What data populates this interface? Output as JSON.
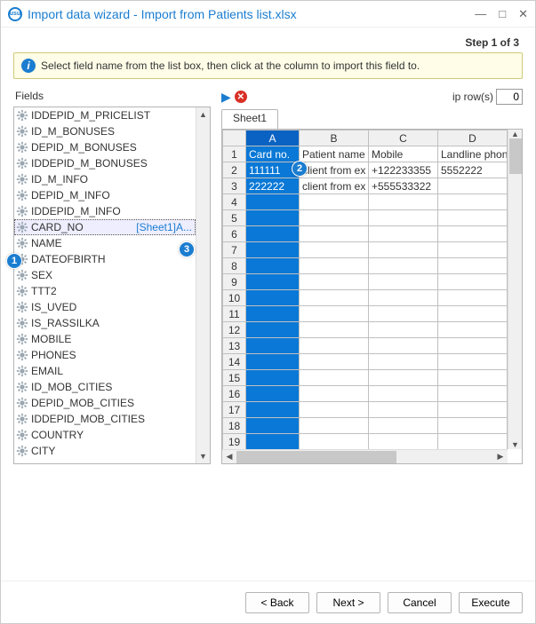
{
  "window": {
    "title": "Import data wizard - Import from Patients list.xlsx"
  },
  "step_label": "Step 1 of 3",
  "info_text": "Select field name from the list box, then click at the column to import this field to.",
  "fields_label": "Fields",
  "fields": [
    {
      "name": "IDDEPID_M_PRICELIST"
    },
    {
      "name": "ID_M_BONUSES"
    },
    {
      "name": "DEPID_M_BONUSES"
    },
    {
      "name": "IDDEPID_M_BONUSES"
    },
    {
      "name": "ID_M_INFO"
    },
    {
      "name": "DEPID_M_INFO"
    },
    {
      "name": "IDDEPID_M_INFO"
    },
    {
      "name": "CARD_NO",
      "selected": true,
      "mapping": "[Sheet1]A..."
    },
    {
      "name": "NAME"
    },
    {
      "name": "DATEOFBIRTH"
    },
    {
      "name": "SEX"
    },
    {
      "name": "TTT2"
    },
    {
      "name": "IS_UVED"
    },
    {
      "name": "IS_RASSILKA"
    },
    {
      "name": "MOBILE"
    },
    {
      "name": "PHONES"
    },
    {
      "name": "EMAIL"
    },
    {
      "name": "ID_MOB_CITIES"
    },
    {
      "name": "DEPID_MOB_CITIES"
    },
    {
      "name": "IDDEPID_MOB_CITIES"
    },
    {
      "name": "COUNTRY"
    },
    {
      "name": "CITY"
    }
  ],
  "skip_label": "ip row(s)",
  "skip_value": "0",
  "sheet_tab": "Sheet1",
  "columns": [
    "A",
    "B",
    "C",
    "D"
  ],
  "chart_data": {
    "type": "table",
    "columns": [
      "A",
      "B",
      "C",
      "D"
    ],
    "rows": [
      {
        "A": "Card no.",
        "B": "Patient name",
        "C": "Mobile",
        "D": "Landline phon"
      },
      {
        "A": "111111",
        "B": "client from ex",
        "C": "+122233355",
        "D": "5552222"
      },
      {
        "A": "222222",
        "B": "client from ex",
        "C": "+555533322",
        "D": ""
      }
    ]
  },
  "callouts": {
    "c1": "1",
    "c2": "2",
    "c3": "3"
  },
  "buttons": {
    "back": "< Back",
    "next": "Next >",
    "cancel": "Cancel",
    "execute": "Execute"
  }
}
